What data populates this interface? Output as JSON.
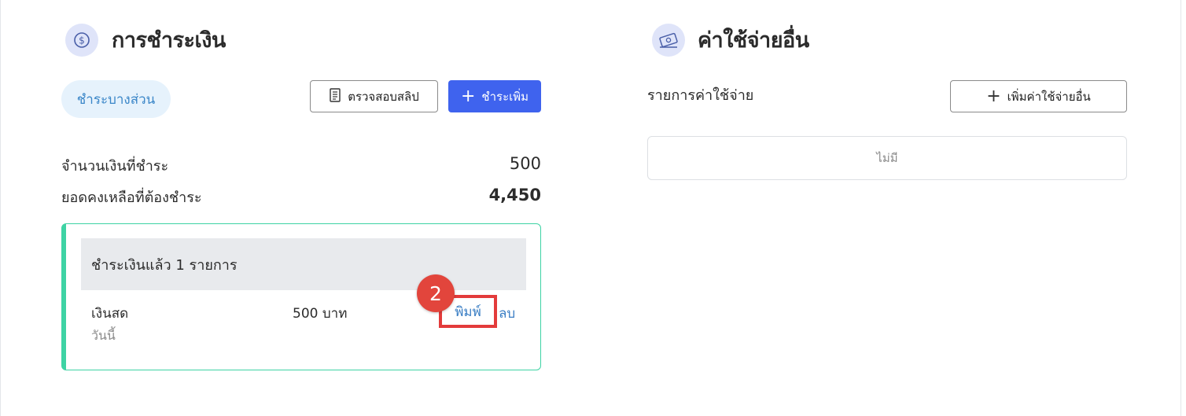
{
  "payment": {
    "title": "การชำระเงิน",
    "icon": "dollar-circle-icon",
    "partial_pill": "ชำระบางส่วน",
    "check_slip_label": "ตรวจสอบสลิป",
    "add_payment_label": "ชำระเพิ่ม",
    "paid_amount_label": "จำนวนเงินที่ชำระ",
    "paid_amount_value": "500",
    "remaining_label": "ยอดคงเหลือที่ต้องชำระ",
    "remaining_value": "4,450",
    "paid_list": {
      "header": "ชำระเงินแล้ว 1 รายการ",
      "items": [
        {
          "method": "เงินสด",
          "date": "วันนี้",
          "amount": "500 บาท",
          "print_label": "พิมพ์",
          "delete_label": "ลบ"
        }
      ]
    },
    "step_badge": "2"
  },
  "expenses": {
    "title": "ค่าใช้จ่ายอื่น",
    "icon": "money-bill-icon",
    "list_label": "รายการค่าใช้จ่าย",
    "add_label": "เพิ่มค่าใช้จ่ายอื่น",
    "empty_text": "ไม่มี"
  },
  "colors": {
    "primary": "#3f63ee",
    "link": "#3a7ec4",
    "accent_green": "#3ed3a4",
    "highlight_red": "#e33b3b",
    "pill_bg": "#e6f2fc",
    "icon_bg": "#dfe4f9"
  }
}
